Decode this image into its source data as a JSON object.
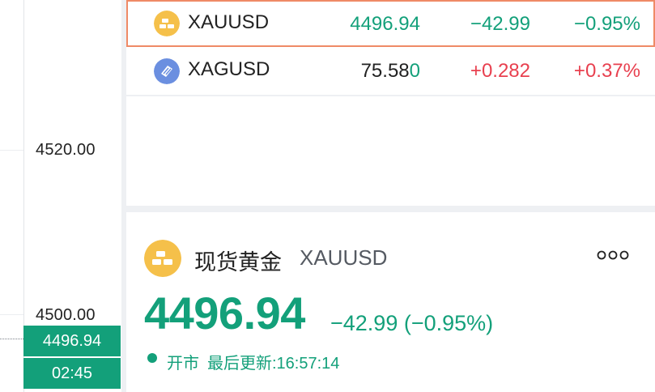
{
  "axis": {
    "labels": [
      "4520.00",
      "4500.00"
    ],
    "current_price": "4496.94",
    "countdown": "02:45"
  },
  "watchlist": [
    {
      "symbol": "XAUUSD",
      "price_main": "4496.94",
      "price_tail": "",
      "change": "−42.99",
      "percent": "−0.95%",
      "icon": "gold-bar-icon",
      "selected": true
    },
    {
      "symbol": "XAGUSD",
      "price_main": "75.58",
      "price_tail": "0",
      "change": "+0.282",
      "percent": "+0.37%",
      "icon": "silver-bar-icon",
      "selected": false
    }
  ],
  "detail": {
    "name": "现货黄金",
    "symbol": "XAUUSD",
    "price": "4496.94",
    "change_text": "−42.99 (−0.95%)",
    "status": "开市",
    "updated": "最后更新:16:57:14"
  },
  "colors": {
    "up": "#e8404f",
    "down": "#13a07a",
    "gold": "#f5c04a",
    "silver": "#6b8fe0",
    "selected_border": "#ef8a66"
  }
}
